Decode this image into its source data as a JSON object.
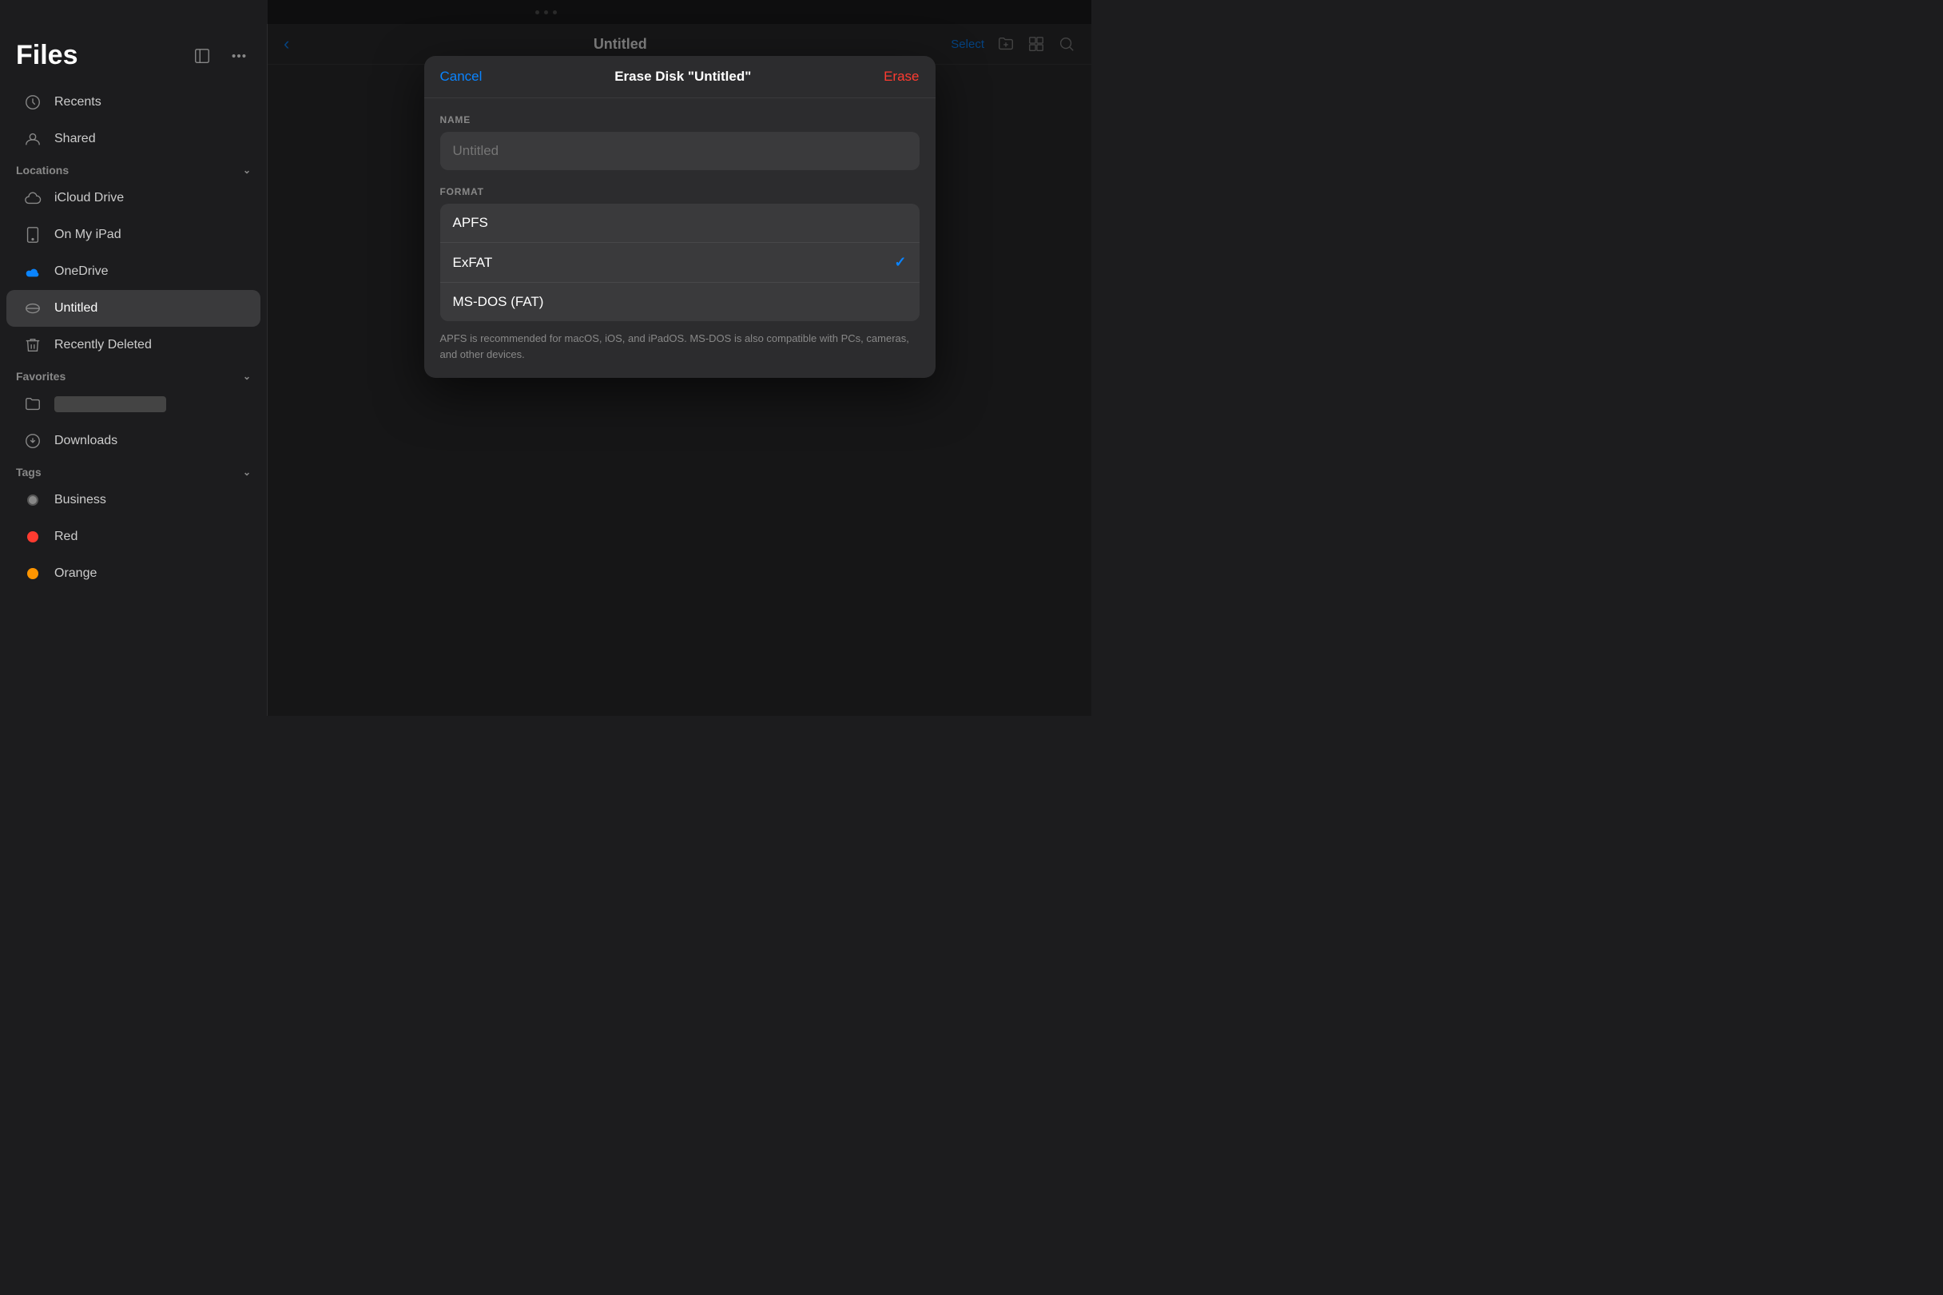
{
  "topbar": {
    "dots": 3
  },
  "sidebar": {
    "title": "Files",
    "icon_sidebar": "sidebar-icon",
    "icon_more": "more-icon",
    "recents_label": "Recents",
    "shared_label": "Shared",
    "locations_section": "Locations",
    "icloud_label": "iCloud Drive",
    "ipad_label": "On My iPad",
    "onedrive_label": "OneDrive",
    "untitled_label": "Untitled",
    "recently_deleted_label": "Recently Deleted",
    "favorites_section": "Favorites",
    "downloads_label": "Downloads",
    "tags_section": "Tags",
    "business_label": "Business",
    "red_label": "Red",
    "orange_label": "Orange",
    "tag_business_color": "#888",
    "tag_red_color": "#ff3b30",
    "tag_orange_color": "#ff9500"
  },
  "main": {
    "back_label": "‹",
    "title": "Untitled",
    "select_label": "Select"
  },
  "dialog": {
    "cancel_label": "Cancel",
    "title": "Erase Disk \"Untitled\"",
    "erase_label": "Erase",
    "name_field_label": "NAME",
    "name_placeholder": "Untitled",
    "format_field_label": "FORMAT",
    "format_options": [
      {
        "label": "APFS",
        "selected": false
      },
      {
        "label": "ExFAT",
        "selected": true
      },
      {
        "label": "MS-DOS (FAT)",
        "selected": false
      }
    ],
    "format_note": "APFS is recommended for macOS, iOS, and iPadOS. MS-DOS is also compatible with PCs, cameras, and other devices."
  }
}
